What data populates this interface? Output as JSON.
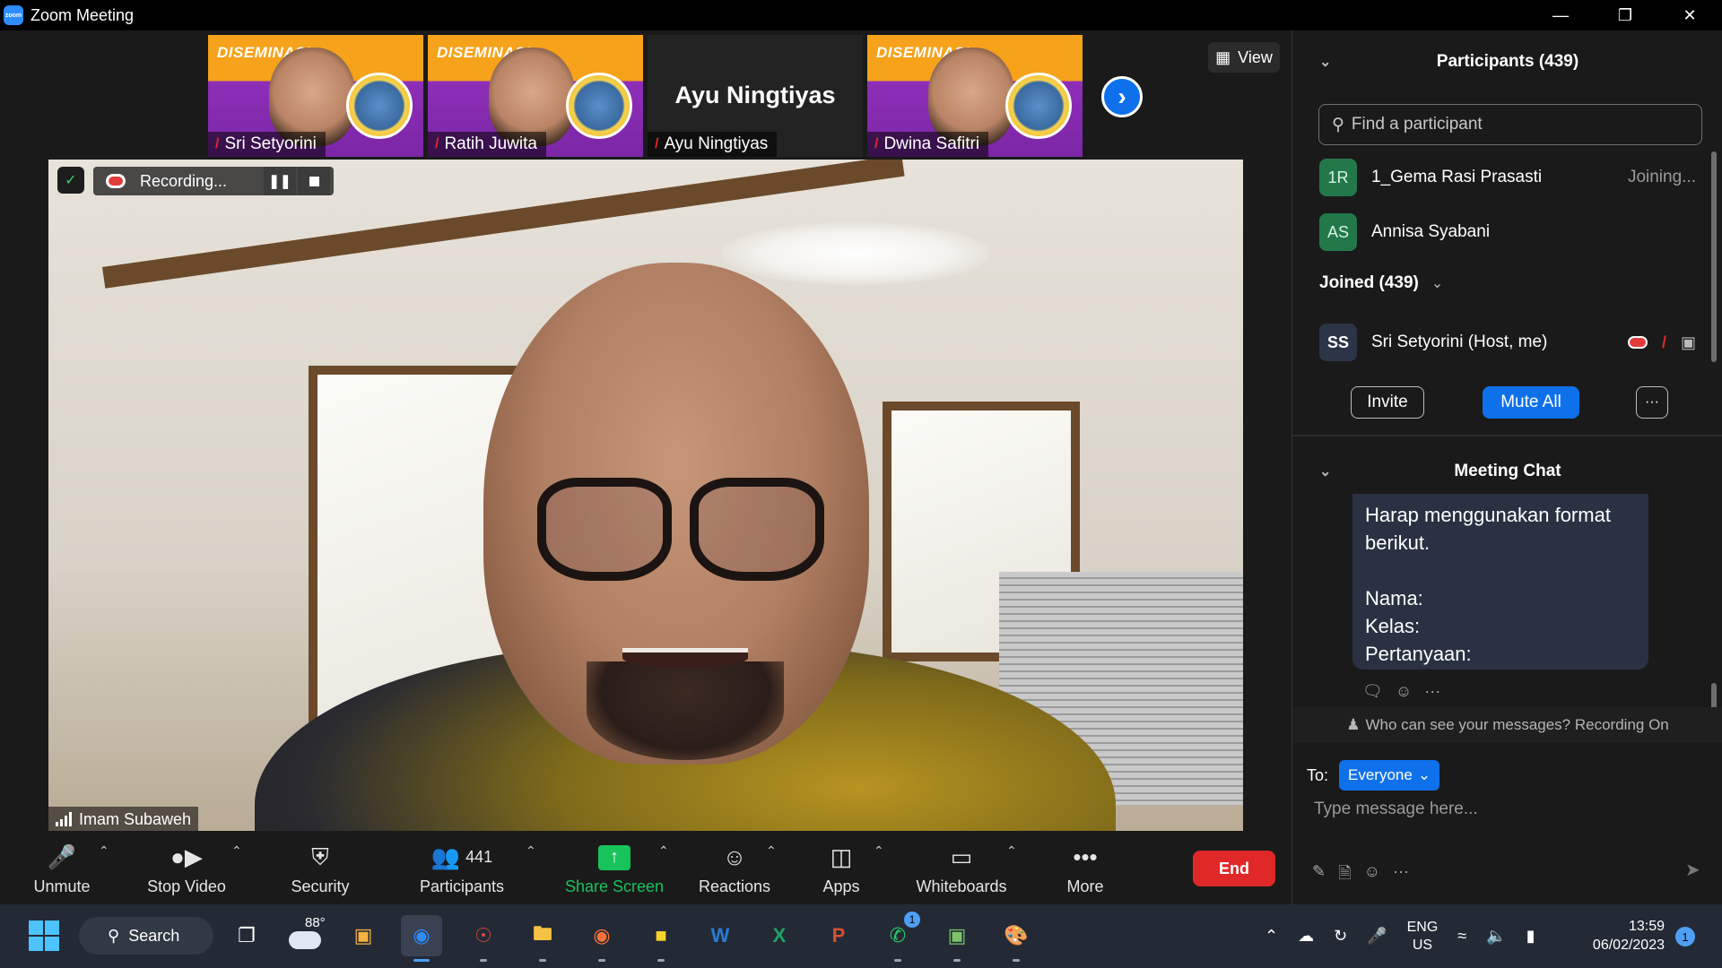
{
  "window": {
    "title": "Zoom Meeting",
    "app_icon_text": "zoom",
    "controls": [
      "minimize",
      "restore",
      "close"
    ]
  },
  "thumbnails": [
    {
      "name": "Sri Setyorini",
      "banner_text": "DISEMINASI",
      "muted": true,
      "has_video": true
    },
    {
      "name": "Ratih Juwita",
      "banner_text": "DISEMINASI",
      "muted": true,
      "has_video": true
    },
    {
      "name": "Ayu Ningtiyas",
      "big_name": "Ayu Ningtiyas",
      "muted": true,
      "has_video": false
    },
    {
      "name": "Dwina Safitri",
      "banner_text": "DISEMINASI",
      "muted": true,
      "has_video": true
    }
  ],
  "view_button": {
    "label": "View",
    "icon": "grid-icon"
  },
  "recording": {
    "label": "Recording...",
    "icon": "cloud-record-icon"
  },
  "speaker": {
    "name": "Imam Subaweh"
  },
  "toolbar": {
    "unmute": "Unmute",
    "stop_video": "Stop Video",
    "security": "Security",
    "participants": "Participants",
    "participants_count": "441",
    "share_screen": "Share Screen",
    "reactions": "Reactions",
    "apps": "Apps",
    "whiteboards": "Whiteboards",
    "more": "More",
    "end": "End",
    "colors": {
      "end": "#e02828",
      "share": "#18c35b"
    }
  },
  "participants_panel": {
    "title": "Participants (439)",
    "search_placeholder": "Find a participant",
    "waiting": [
      {
        "initials": "1R",
        "name": "1_Gema Rasi Prasasti",
        "status": "Joining...",
        "color": "#23784a"
      },
      {
        "initials": "AS",
        "name": "Annisa Syabani",
        "status": "",
        "color": "#23784a"
      }
    ],
    "joined_label": "Joined (439)",
    "host": {
      "initials": "SS",
      "name": "Sri Setyorini (Host, me)",
      "color": "#2c3447"
    },
    "invite": "Invite",
    "mute_all": "Mute All",
    "more": "···"
  },
  "chat_panel": {
    "title": "Meeting Chat",
    "message_lines": [
      "Harap menggunakan format",
      "berikut.",
      "",
      "Nama:",
      "Kelas:",
      "Pertanyaan:"
    ],
    "privacy_text": "Who can see your messages? Recording On",
    "to_label": "To:",
    "to_value": "Everyone",
    "input_placeholder": "Type message here..."
  },
  "taskbar": {
    "search_label": "Search",
    "weather_temp": "88°",
    "whatsapp_badge": "1",
    "language_line1": "ENG",
    "language_line2": "US",
    "time": "13:59",
    "date": "06/02/2023",
    "notification_count": "1"
  }
}
